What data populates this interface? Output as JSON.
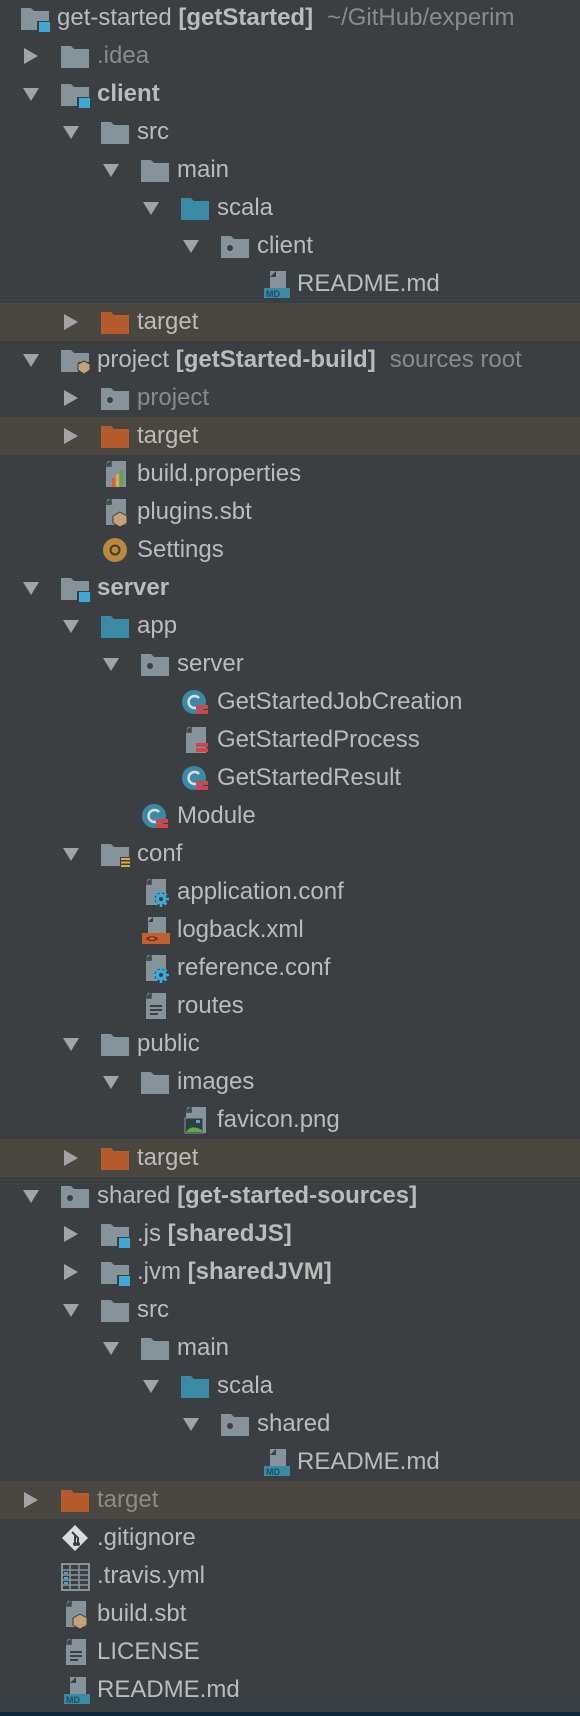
{
  "panel": "Project tree",
  "colors": {
    "background": "#3c3f41",
    "highlight_row": "#4a4740",
    "text": "#bbbbbb",
    "dim_text": "#8a8a8a",
    "folder_gray": "#87939a",
    "folder_source": "#3a8aa6",
    "folder_excluded": "#b65c2c",
    "module_badge": "#3fa9d6"
  },
  "rows": [
    {
      "level": 0,
      "arrow": "none",
      "icon": "module-folder-icon",
      "name": "get-started",
      "bold_part": "[getStarted]",
      "hint": "~/GitHub/experim"
    },
    {
      "level": 1,
      "arrow": "collapsed",
      "icon": "folder-icon",
      "name": ".idea",
      "dim": true
    },
    {
      "level": 1,
      "arrow": "expanded",
      "icon": "module-folder-icon",
      "name": "client",
      "name_bold": true
    },
    {
      "level": 2,
      "arrow": "expanded",
      "icon": "folder-icon",
      "name": "src"
    },
    {
      "level": 3,
      "arrow": "expanded",
      "icon": "folder-icon",
      "name": "main"
    },
    {
      "level": 4,
      "arrow": "expanded",
      "icon": "source-folder-icon",
      "name": "scala"
    },
    {
      "level": 5,
      "arrow": "expanded",
      "icon": "package-icon",
      "name": "client"
    },
    {
      "level": 6,
      "arrow": "none",
      "icon": "markdown-file-icon",
      "name": "README.md"
    },
    {
      "level": 2,
      "arrow": "collapsed",
      "icon": "excluded-folder-icon",
      "name": "target",
      "highlight": true
    },
    {
      "level": 1,
      "arrow": "expanded",
      "icon": "sbt-folder-icon",
      "name": "project",
      "bold_part": "[getStarted-build]",
      "hint": "sources root"
    },
    {
      "level": 2,
      "arrow": "collapsed",
      "icon": "package-icon",
      "name": "project",
      "dim": true
    },
    {
      "level": 2,
      "arrow": "collapsed",
      "icon": "excluded-folder-icon",
      "name": "target",
      "highlight": true
    },
    {
      "level": 2,
      "arrow": "none",
      "icon": "properties-file-icon",
      "name": "build.properties"
    },
    {
      "level": 2,
      "arrow": "none",
      "icon": "sbt-file-icon",
      "name": "plugins.sbt"
    },
    {
      "level": 2,
      "arrow": "none",
      "icon": "settings-icon",
      "name": "Settings"
    },
    {
      "level": 1,
      "arrow": "expanded",
      "icon": "module-folder-icon",
      "name": "server",
      "name_bold": true
    },
    {
      "level": 2,
      "arrow": "expanded",
      "icon": "source-folder-icon",
      "name": "app"
    },
    {
      "level": 3,
      "arrow": "expanded",
      "icon": "package-icon",
      "name": "server"
    },
    {
      "level": 4,
      "arrow": "none",
      "icon": "scala-class-icon",
      "name": "GetStartedJobCreation"
    },
    {
      "level": 4,
      "arrow": "none",
      "icon": "scala-file-icon",
      "name": "GetStartedProcess"
    },
    {
      "level": 4,
      "arrow": "none",
      "icon": "scala-class-icon",
      "name": "GetStartedResult"
    },
    {
      "level": 3,
      "arrow": "none",
      "icon": "scala-class-icon",
      "name": "Module"
    },
    {
      "level": 2,
      "arrow": "expanded",
      "icon": "resources-folder-icon",
      "name": "conf"
    },
    {
      "level": 3,
      "arrow": "none",
      "icon": "config-file-icon",
      "name": "application.conf"
    },
    {
      "level": 3,
      "arrow": "none",
      "icon": "xml-file-icon",
      "name": "logback.xml"
    },
    {
      "level": 3,
      "arrow": "none",
      "icon": "config-file-icon",
      "name": "reference.conf"
    },
    {
      "level": 3,
      "arrow": "none",
      "icon": "text-file-icon",
      "name": "routes"
    },
    {
      "level": 2,
      "arrow": "expanded",
      "icon": "folder-icon",
      "name": "public"
    },
    {
      "level": 3,
      "arrow": "expanded",
      "icon": "folder-icon",
      "name": "images"
    },
    {
      "level": 4,
      "arrow": "none",
      "icon": "image-file-icon",
      "name": "favicon.png"
    },
    {
      "level": 2,
      "arrow": "collapsed",
      "icon": "excluded-folder-icon",
      "name": "target",
      "highlight": true
    },
    {
      "level": 1,
      "arrow": "expanded",
      "icon": "package-icon",
      "name": "shared",
      "bold_part": "[get-started-sources]"
    },
    {
      "level": 2,
      "arrow": "collapsed",
      "icon": "module-folder-icon",
      "name": ".js",
      "bold_part": "[sharedJS]"
    },
    {
      "level": 2,
      "arrow": "collapsed",
      "icon": "module-folder-icon",
      "name": ".jvm",
      "bold_part": "[sharedJVM]"
    },
    {
      "level": 2,
      "arrow": "expanded",
      "icon": "folder-icon",
      "name": "src"
    },
    {
      "level": 3,
      "arrow": "expanded",
      "icon": "folder-icon",
      "name": "main"
    },
    {
      "level": 4,
      "arrow": "expanded",
      "icon": "source-folder-icon",
      "name": "scala"
    },
    {
      "level": 5,
      "arrow": "expanded",
      "icon": "package-icon",
      "name": "shared"
    },
    {
      "level": 6,
      "arrow": "none",
      "icon": "markdown-file-icon",
      "name": "README.md"
    },
    {
      "level": 1,
      "arrow": "collapsed",
      "icon": "excluded-folder-icon",
      "name": "target",
      "highlight": true,
      "dim": true
    },
    {
      "level": 1,
      "arrow": "none",
      "icon": "gitignore-file-icon",
      "name": ".gitignore"
    },
    {
      "level": 1,
      "arrow": "none",
      "icon": "yaml-file-icon",
      "name": ".travis.yml"
    },
    {
      "level": 1,
      "arrow": "none",
      "icon": "sbt-file-icon",
      "name": "build.sbt"
    },
    {
      "level": 1,
      "arrow": "none",
      "icon": "text-file-icon",
      "name": "LICENSE"
    },
    {
      "level": 1,
      "arrow": "none",
      "icon": "markdown-file-icon",
      "name": "README.md"
    }
  ]
}
